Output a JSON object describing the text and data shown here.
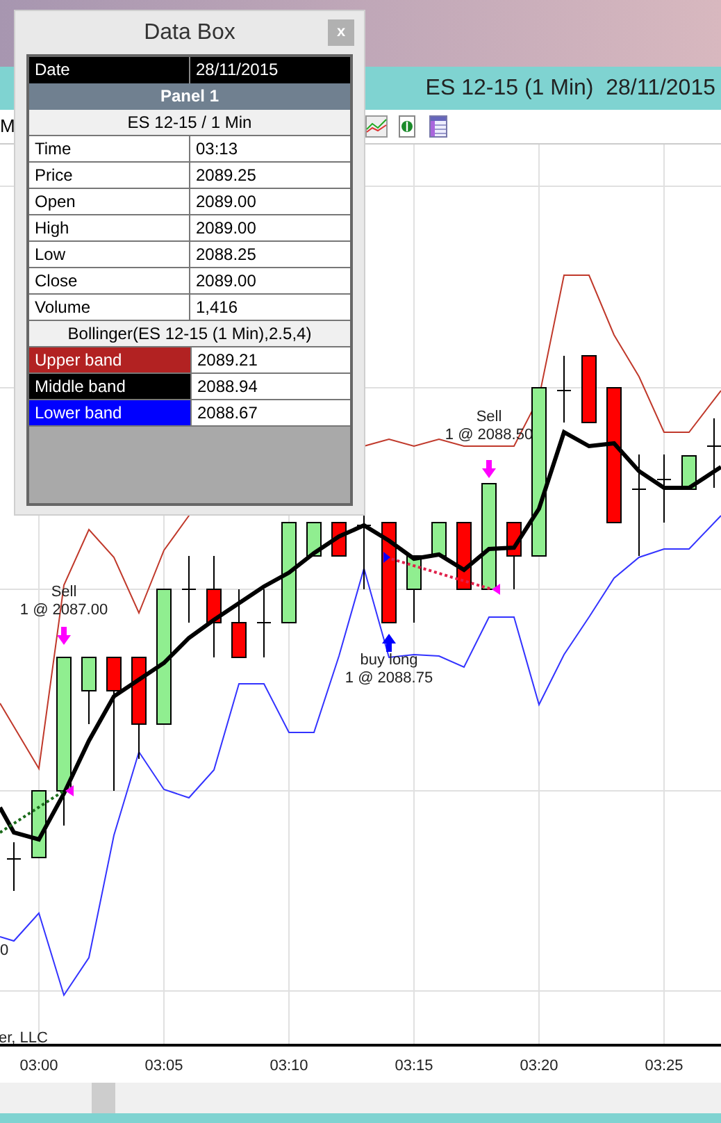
{
  "chart_window": {
    "title": "ES 12-15 (1 Min)  28/11/2015"
  },
  "toolbar": {
    "menu_text": "M"
  },
  "chart": {
    "price_label": "0",
    "copyright_fragment": "er, LLC",
    "x_axis_labels": [
      "03:00",
      "03:05",
      "03:10",
      "03:15",
      "03:20",
      "03:25"
    ],
    "trades": [
      {
        "kind": "sell",
        "action": "Sell",
        "fill": "1 @ 2087.00"
      },
      {
        "kind": "buy",
        "action": "buy long",
        "fill": "1 @ 2088.75"
      },
      {
        "kind": "sell",
        "action": "Sell",
        "fill": "1 @ 2088.50"
      }
    ]
  },
  "data_box": {
    "title": "Data Box",
    "close": "x",
    "date": {
      "label": "Date",
      "value": "28/11/2015"
    },
    "panel": "Panel 1",
    "series": "ES 12-15 / 1 Min",
    "rows": [
      {
        "label": "Time",
        "value": "03:13"
      },
      {
        "label": "Price",
        "value": "2089.25"
      },
      {
        "label": "Open",
        "value": "2089.00"
      },
      {
        "label": "High",
        "value": "2089.00"
      },
      {
        "label": "Low",
        "value": "2088.25"
      },
      {
        "label": "Close",
        "value": "2089.00"
      },
      {
        "label": "Volume",
        "value": "1,416"
      }
    ],
    "indicator": "Bollinger(ES 12-15 (1 Min),2.5,4)",
    "bands": [
      {
        "label": "Upper band",
        "value": "2089.21",
        "color": "#b22222"
      },
      {
        "label": "Middle band",
        "value": "2088.94",
        "color": "#000000"
      },
      {
        "label": "Lower band",
        "value": "2088.67",
        "color": "#0000ff"
      }
    ]
  }
}
